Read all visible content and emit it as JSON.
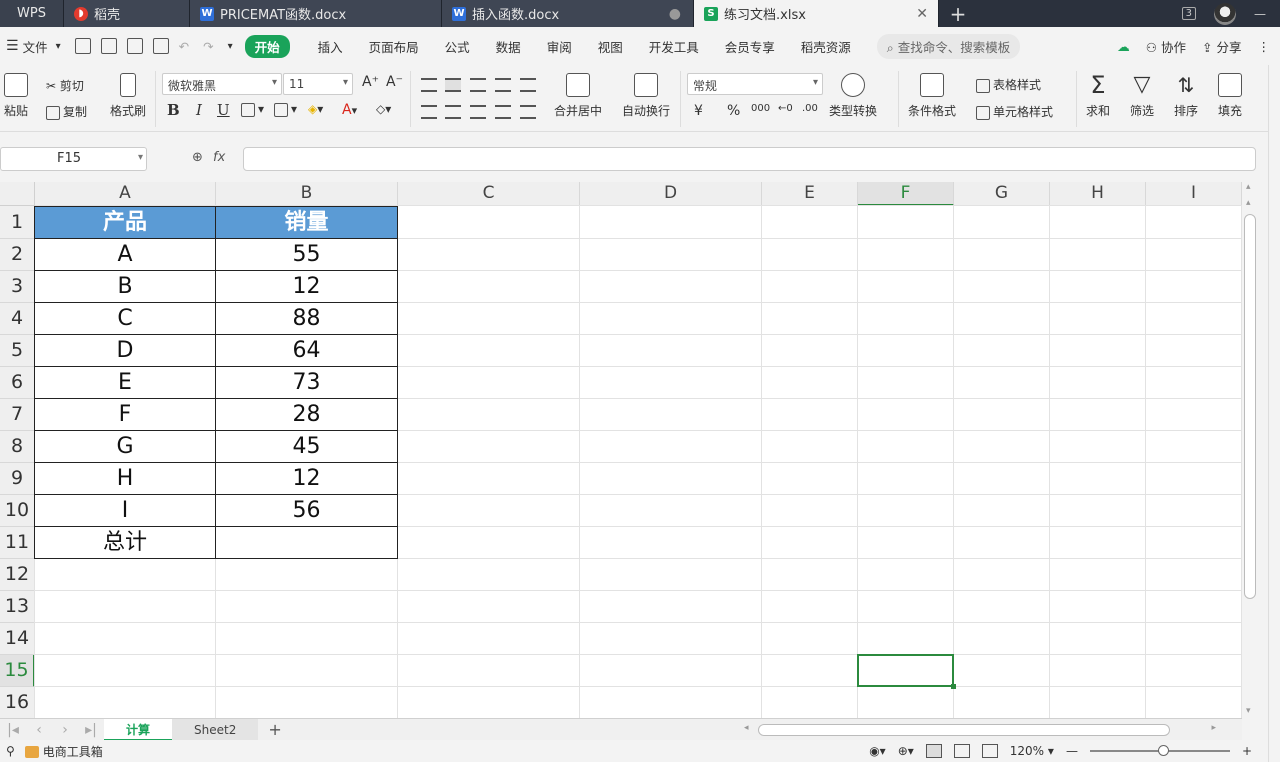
{
  "tabs": {
    "wps": "WPS",
    "daoke": "稻壳",
    "doc1": "PRICEMAT函数.docx",
    "doc2": "插入函数.docx",
    "active": "练习文档.xlsx",
    "badge": "3"
  },
  "menu": {
    "file": "文件",
    "items": [
      "开始",
      "插入",
      "页面布局",
      "公式",
      "数据",
      "审阅",
      "视图",
      "开发工具",
      "会员专享",
      "稻壳资源"
    ],
    "search_placeholder": "查找命令、搜索模板",
    "collab": "协作",
    "share": "分享"
  },
  "ribbon": {
    "paste": "粘贴",
    "cut": "剪切",
    "copy": "复制",
    "format_painter": "格式刷",
    "font_name": "微软雅黑",
    "font_size": "11",
    "bold": "B",
    "italic": "I",
    "underline": "U",
    "merge_center": "合并居中",
    "wrap_text": "自动换行",
    "number_format": "常规",
    "currency": "¥",
    "percent": "%",
    "thousands": "000",
    "type_convert": "类型转换",
    "cond_format": "条件格式",
    "table_style": "表格样式",
    "cell_style": "单元格样式",
    "sum": "求和",
    "filter": "筛选",
    "sort": "排序",
    "fill": "填充"
  },
  "formula_bar": {
    "name_box": "F15",
    "fx": "fx",
    "formula": ""
  },
  "grid": {
    "columns": [
      "A",
      "B",
      "C",
      "D",
      "E",
      "F",
      "G",
      "H",
      "I"
    ],
    "selected_column": "F",
    "rows": [
      "1",
      "2",
      "3",
      "4",
      "5",
      "6",
      "7",
      "8",
      "9",
      "10",
      "11",
      "12",
      "13",
      "14",
      "15",
      "16"
    ],
    "selected_row": "15",
    "table": {
      "header": [
        "产品",
        "销量"
      ],
      "rows": [
        [
          "A",
          "55"
        ],
        [
          "B",
          "12"
        ],
        [
          "C",
          "88"
        ],
        [
          "D",
          "64"
        ],
        [
          "E",
          "73"
        ],
        [
          "F",
          "28"
        ],
        [
          "G",
          "45"
        ],
        [
          "H",
          "12"
        ],
        [
          "I",
          "56"
        ],
        [
          "总计",
          ""
        ]
      ]
    },
    "header_color": "#5b9bd5",
    "selection_color": "#2b8a3e"
  },
  "sheets": {
    "active": "计算",
    "other": "Sheet2"
  },
  "status": {
    "toolbox": "电商工具箱",
    "zoom": "120%"
  }
}
